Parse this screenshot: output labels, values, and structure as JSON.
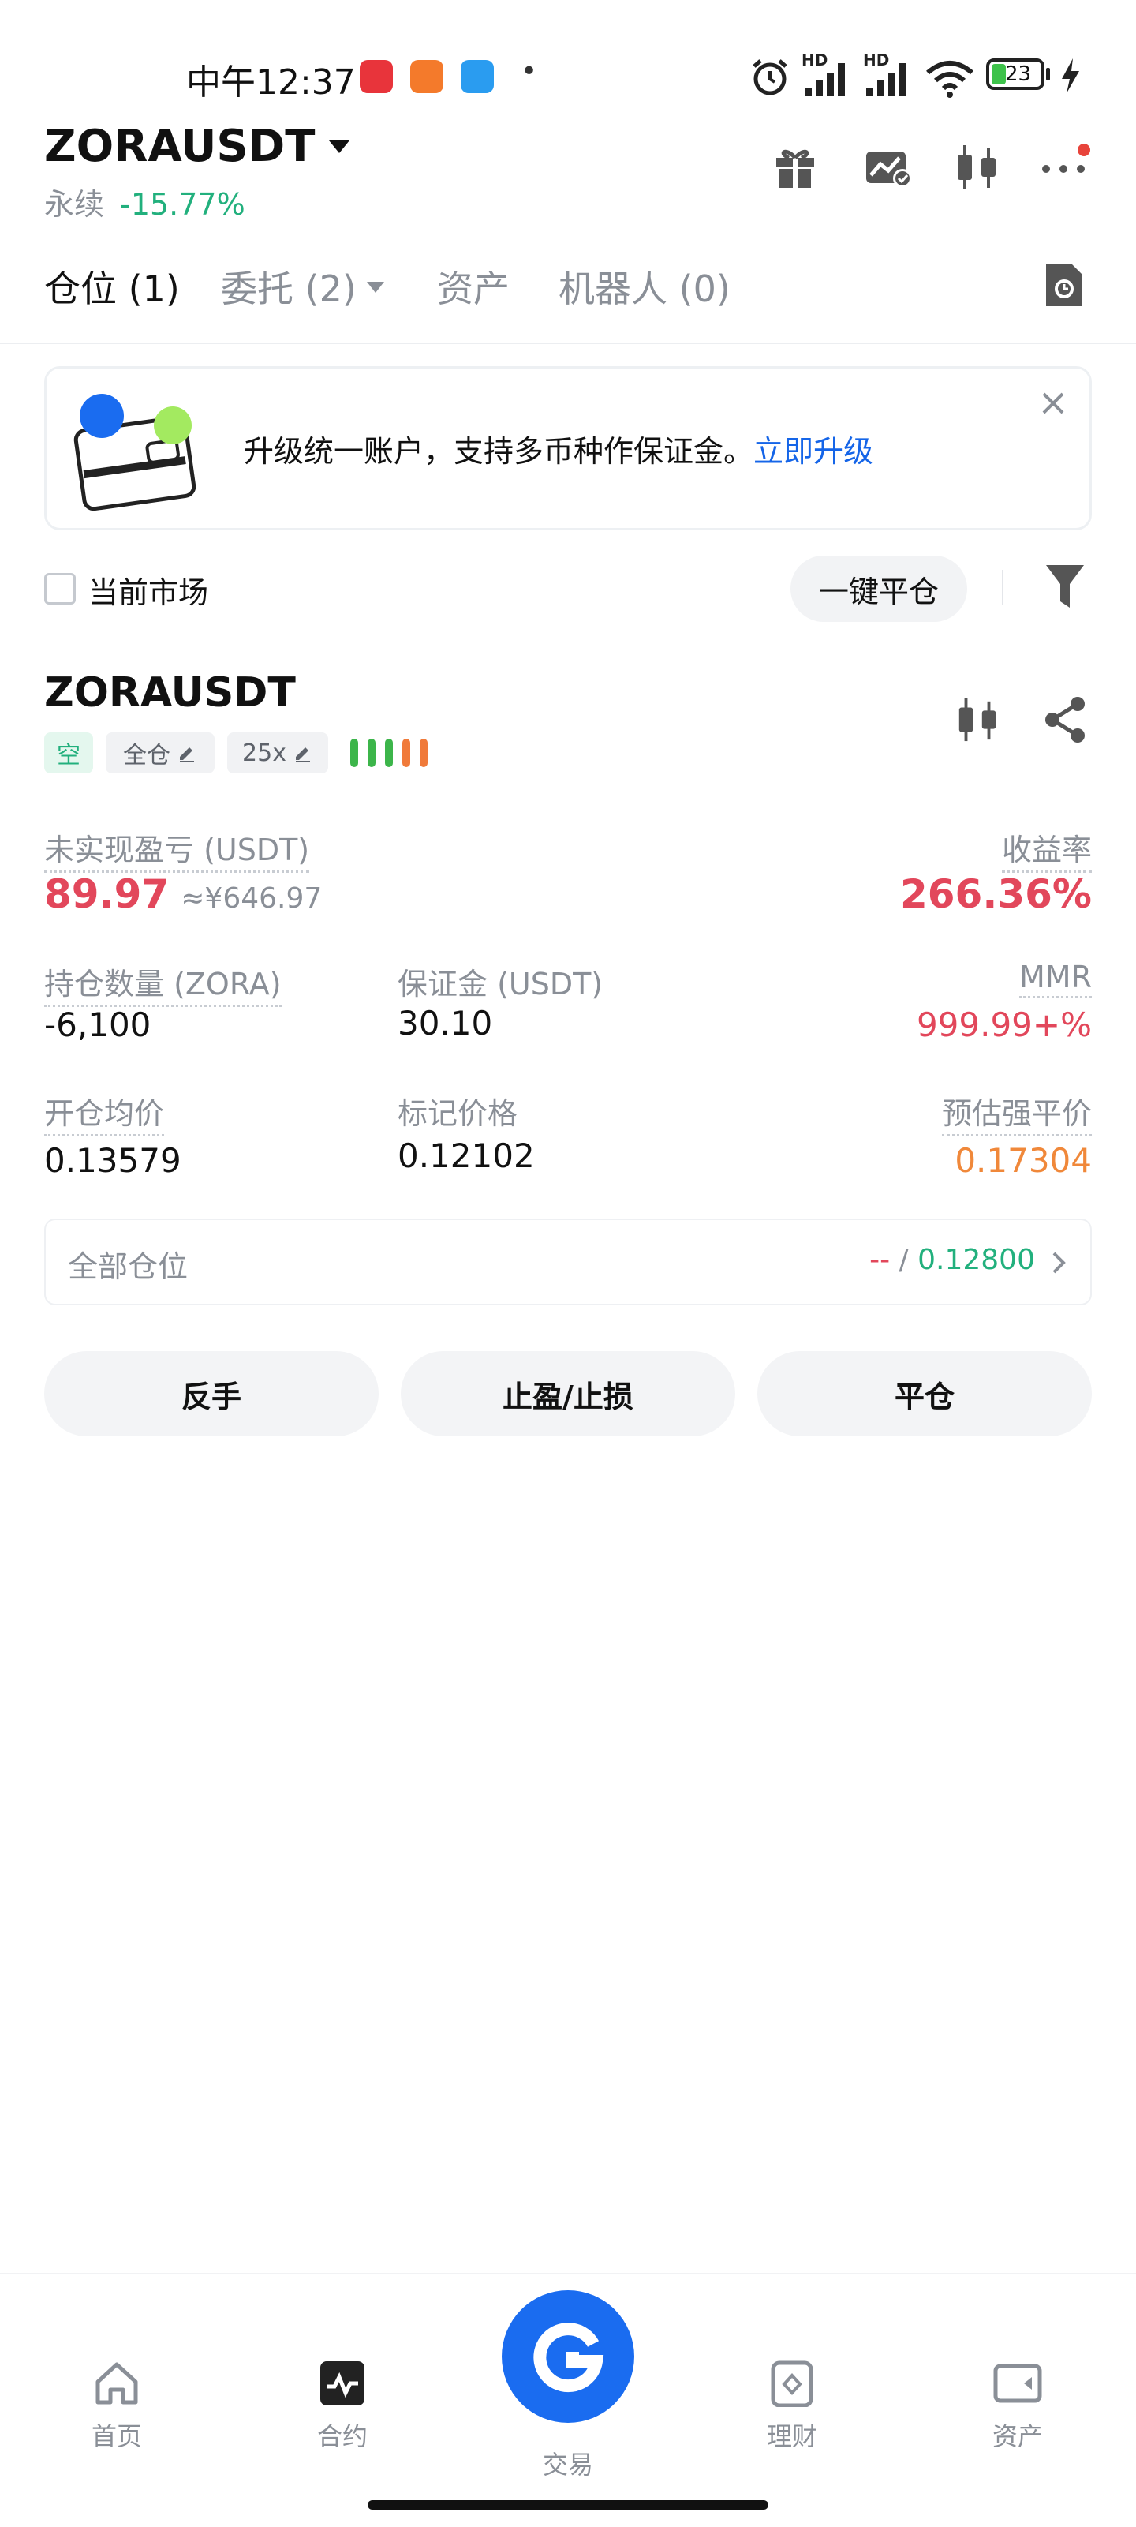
{
  "status_bar": {
    "time": "中午12:37",
    "dot": "•",
    "signal1_label": "HD",
    "signal2_label": "HD",
    "battery": "23"
  },
  "header": {
    "symbol": "ZORAUSDT",
    "contract_type": "永续",
    "change": "-15.77%"
  },
  "tabs": [
    {
      "label": "仓位 (1)"
    },
    {
      "label": "委托 (2)"
    },
    {
      "label": "资产"
    },
    {
      "label": "机器人 (0)"
    }
  ],
  "banner": {
    "text": "升级统一账户，支持多币种作保证金。",
    "link": "立即升级"
  },
  "filter": {
    "current_market": "当前市场",
    "close_all": "一键平仓"
  },
  "position": {
    "symbol": "ZORAUSDT",
    "side_tag": "空",
    "margin_mode": "全仓",
    "leverage": "25x",
    "unrealized_pnl_label": "未实现盈亏 (USDT)",
    "unrealized_pnl": "89.97",
    "unrealized_pnl_cny": "≈¥646.97",
    "roe_label": "收益率",
    "roe": "266.36%",
    "size_label": "持仓数量 (ZORA)",
    "size": "-6,100",
    "margin_label": "保证金 (USDT)",
    "margin": "30.10",
    "mmr_label": "MMR",
    "mmr": "999.99+%",
    "entry_label": "开仓均价",
    "entry": "0.13579",
    "mark_label": "标记价格",
    "mark": "0.12102",
    "liq_label": "预估强平价",
    "liq": "0.17304",
    "all_positions_label": "全部仓位",
    "all_positions_left": "--",
    "all_positions_sep": "/",
    "all_positions_right": "0.12800"
  },
  "actions": {
    "reverse": "反手",
    "tpsl": "止盈/止损",
    "close": "平仓"
  },
  "bottom_nav": [
    {
      "label": "首页",
      "icon": "home-icon"
    },
    {
      "label": "合约",
      "icon": "futures-icon"
    },
    {
      "label": "交易",
      "icon": "trade-logo-icon"
    },
    {
      "label": "理财",
      "icon": "earn-icon"
    },
    {
      "label": "资产",
      "icon": "wallet-icon"
    }
  ],
  "colors": {
    "green": "#22b07d",
    "red": "#e2475b",
    "orange": "#f0883a",
    "blue": "#1565e8"
  }
}
